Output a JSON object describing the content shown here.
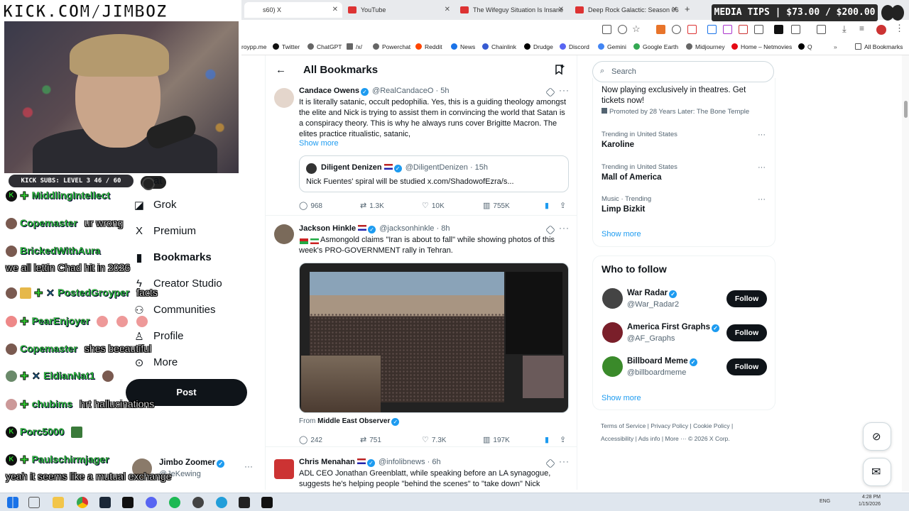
{
  "overlay": {
    "kick_logo": "KICK.COM/JIMBOZ",
    "media_tips": "MEDIA TIPS | $73.00 / $200.00",
    "subs": "KICK SUBS: LEVEL 3 46 / 60"
  },
  "browser": {
    "tabs": [
      {
        "label": "s60) X",
        "icon_color": "#111111"
      },
      {
        "label": "YouTube",
        "icon_color": "#ff0033"
      },
      {
        "label": "The Wifeguy Situation Is Insane",
        "icon_color": "#ff0033"
      },
      {
        "label": "Deep Rock Galactic: Season 06",
        "icon_color": "#ff0033"
      }
    ],
    "new_tab": "+",
    "bookmarks": [
      "roypp.me",
      "Twitter",
      "ChatGPT",
      "/x/",
      "Powerchat",
      "Reddit",
      "News",
      "Chainlink",
      "Drudge",
      "Discord",
      "Gemini",
      "Google Earth",
      "Midjourney",
      "Home – Netmovies",
      "Q"
    ],
    "all_bookmarks": "All Bookmarks"
  },
  "chat": [
    {
      "name": "MiddlingIntellect",
      "msg": ""
    },
    {
      "name": "Copemaster",
      "msg": "ur wrong"
    },
    {
      "name": "BrickedWithAura",
      "msg": ""
    },
    {
      "name": "",
      "msg": "we all lettin Chad hit in 2026"
    },
    {
      "name": "PostedGroyper",
      "msg": "facts"
    },
    {
      "name": "PearEnjoyer",
      "msg": ""
    },
    {
      "name": "Copemaster",
      "msg": "shes beeautiful"
    },
    {
      "name": "EldianNat1",
      "msg": ""
    },
    {
      "name": "chubims",
      "msg": "hrt hallucinations"
    },
    {
      "name": "Porc5000",
      "msg": ""
    },
    {
      "name": "Paulschirmjager",
      "msg": ""
    },
    {
      "name": "",
      "msg": "yeah it seems like a mutual exchange"
    }
  ],
  "leftnav": {
    "items": [
      "Grok",
      "Premium",
      "Bookmarks",
      "Creator Studio",
      "Communities",
      "Profile",
      "More"
    ],
    "partial": "at",
    "post": "Post",
    "account_name": "Jimbo Zoomer",
    "account_handle": "@JeKewing"
  },
  "feed": {
    "title": "All Bookmarks",
    "tweets": [
      {
        "name": "Candace Owens",
        "handle": "@RealCandaceO · 5h",
        "text": "It is literally satanic, occult pedophilia. Yes, this is a guiding theology amongst the elite and Nick is trying to assist them in convincing the world that Satan is a conspiracy theory. This is why he always runs cover Brigitte Macron. The elites practice ritualistic, satanic,",
        "show_more": "Show more",
        "quote": {
          "name": "Diligent Denizen",
          "handle": "@DiligentDenizen · 15h",
          "text": "Nick Fuentes' spiral will be studied x.com/ShadowofEzra/s..."
        },
        "stats": {
          "replies": "968",
          "reposts": "1.3K",
          "likes": "10K",
          "views": "755K"
        }
      },
      {
        "name": "Jackson Hinkle",
        "handle": "@jacksonhinkle · 8h",
        "text": "Asmongold claims \"Iran is about to fall\" while showing photos of this week's PRO-GOVERNMENT rally in Tehran.",
        "from_label": "From",
        "from_source": "Middle East Observer",
        "stats": {
          "replies": "242",
          "reposts": "751",
          "likes": "7.3K",
          "views": "197K"
        }
      },
      {
        "name": "Chris Menahan",
        "handle": "@infolibnews · 6h",
        "text": "ADL CEO Jonathan Greenblatt, while speaking before an LA synagogue, suggests he's helping people \"behind the scenes\" to \"take down\" Nick"
      }
    ]
  },
  "right": {
    "search_placeholder": "Search",
    "promo_text": "Now playing exclusively in theatres. Get tickets now!",
    "promo_by": "Promoted by 28 Years Later: The Bone Temple",
    "trends": [
      {
        "context": "Trending in United States",
        "name": "Karoline"
      },
      {
        "context": "Trending in United States",
        "name": "Mall of America"
      },
      {
        "context": "Music · Trending",
        "name": "Limp Bizkit"
      }
    ],
    "show_more": "Show more",
    "who_to_follow": "Who to follow",
    "follow_label": "Follow",
    "accounts": [
      {
        "name": "War Radar",
        "handle": "@War_Radar2",
        "color": "#444444"
      },
      {
        "name": "America First Graphs",
        "handle": "@AF_Graphs",
        "color": "#7a1f2a"
      },
      {
        "name": "Billboard Meme",
        "handle": "@billboardmeme",
        "color": "#3a8a2a"
      }
    ],
    "show_more_2": "Show more",
    "footer": [
      "Terms of Service",
      "Privacy Policy",
      "Cookie Policy",
      "Accessibility",
      "Ads info",
      "More ···",
      "© 2026 X Corp."
    ]
  },
  "taskbar": {
    "lang": "ENG",
    "time": "4:28 PM",
    "date": "1/15/2026"
  },
  "colors": {
    "accent": "#1d9bf0",
    "chat_name": "#2fcc44",
    "kick_green": "#53fc18"
  }
}
